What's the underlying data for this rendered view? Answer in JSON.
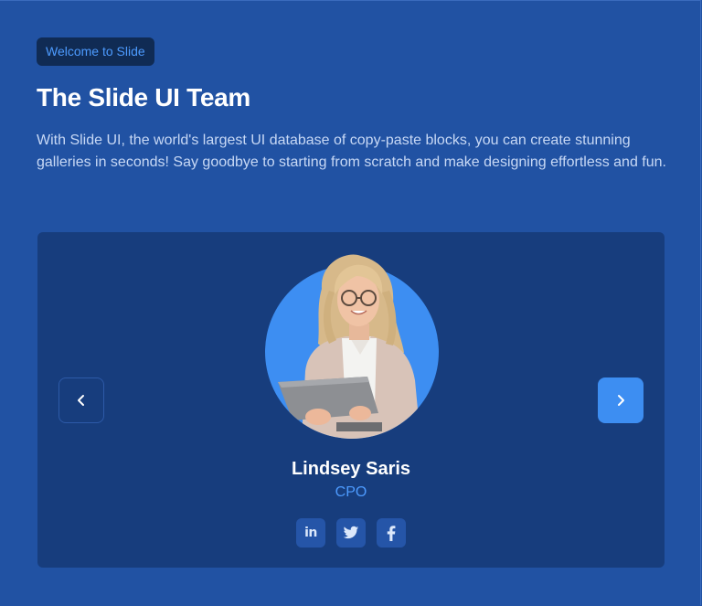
{
  "header": {
    "badge": "Welcome to Slide",
    "title": "The Slide UI Team",
    "description": "With Slide UI, the world's largest UI database of copy-paste blocks, you can create stunning galleries in seconds! Say goodbye to starting from scratch and make designing effortless and fun."
  },
  "carousel": {
    "prev_icon": "chevron-left-icon",
    "next_icon": "chevron-right-icon",
    "member": {
      "name": "Lindsey Saris",
      "role": "CPO",
      "photo": "team-member-photo"
    },
    "socials": [
      {
        "icon": "linkedin-icon",
        "label": "in"
      },
      {
        "icon": "twitter-icon"
      },
      {
        "icon": "facebook-icon"
      }
    ]
  },
  "colors": {
    "background": "#2152a3",
    "card": "#173d7d",
    "accent": "#3d8ef2",
    "badge_bg": "#102b54",
    "role_text": "#4d9bff"
  }
}
